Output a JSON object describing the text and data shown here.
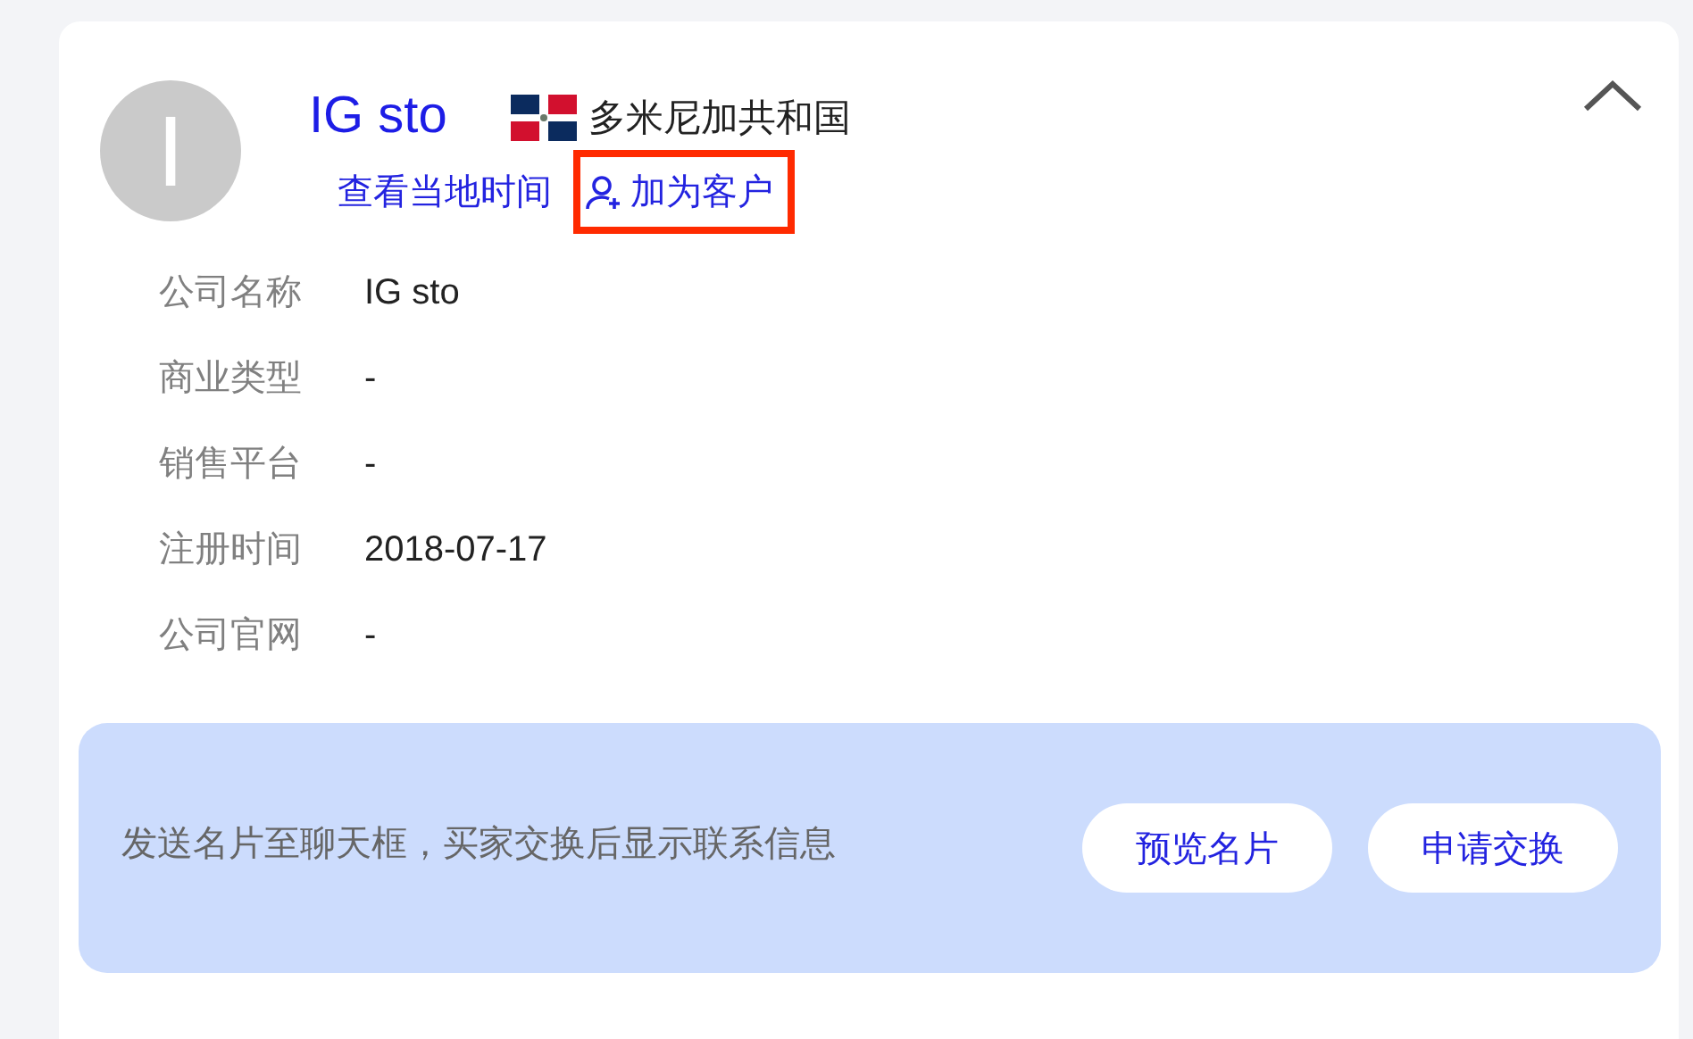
{
  "contact": {
    "avatar_letter": "I",
    "name": "IG sto",
    "country": "多米尼加共和国",
    "expanded": true,
    "links": [
      {
        "label": "查看当地时间",
        "kind": "plain",
        "highlighted": false
      },
      {
        "label": "加为客户",
        "kind": "add-user",
        "highlighted": true
      }
    ]
  },
  "fields": [
    {
      "label": "公司名称",
      "value": "IG sto"
    },
    {
      "label": "商业类型",
      "value": "-"
    },
    {
      "label": "销售平台",
      "value": "-"
    },
    {
      "label": "注册时间",
      "value": "2018-07-17"
    },
    {
      "label": "公司官网",
      "value": "-"
    }
  ],
  "banner": {
    "message": "发送名片至聊天框，买家交换后显示联系信息",
    "buttons": [
      "预览名片",
      "申请交换"
    ]
  }
}
